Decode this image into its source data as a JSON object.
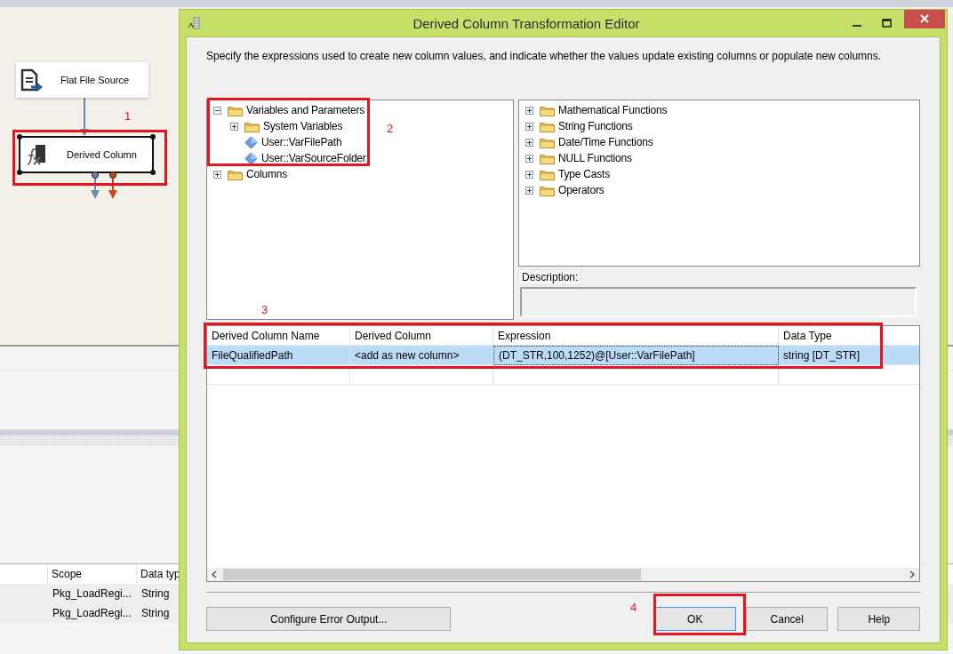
{
  "designer": {
    "nodes": [
      {
        "kind": "source",
        "label": "Flat File Source",
        "selected": false
      },
      {
        "kind": "derived",
        "label": "Derived Column",
        "selected": true,
        "callout": "1"
      }
    ]
  },
  "variables_grid": {
    "columns": [
      "Scope",
      "Data typ"
    ],
    "rows": [
      [
        "Pkg_LoadRegi...",
        "String"
      ],
      [
        "Pkg_LoadRegi...",
        "String"
      ]
    ]
  },
  "dialog": {
    "title": "Derived Column Transformation Editor",
    "instructions": "Specify the expressions used to create new column values, and indicate whether the values update existing columns or populate new columns.",
    "variables_tree": {
      "callout": "2",
      "items": [
        {
          "kind": "folder",
          "label": "Variables and Parameters",
          "expanded": true,
          "children": [
            {
              "kind": "folder",
              "label": "System Variables",
              "expanded": false
            },
            {
              "kind": "variable",
              "label": "User::VarFilePath"
            },
            {
              "kind": "variable",
              "label": "User::VarSourceFolder"
            }
          ]
        },
        {
          "kind": "folder",
          "label": "Columns",
          "expanded": false
        }
      ]
    },
    "functions_tree": {
      "items": [
        {
          "kind": "folder",
          "label": "Mathematical Functions",
          "expanded": false
        },
        {
          "kind": "folder",
          "label": "String Functions",
          "expanded": false
        },
        {
          "kind": "folder",
          "label": "Date/Time Functions",
          "expanded": false
        },
        {
          "kind": "folder",
          "label": "NULL Functions",
          "expanded": false
        },
        {
          "kind": "folder",
          "label": "Type Casts",
          "expanded": false
        },
        {
          "kind": "folder",
          "label": "Operators",
          "expanded": false
        }
      ]
    },
    "description_label": "Description:",
    "grid": {
      "callout": "3",
      "columns": [
        "Derived Column Name",
        "Derived Column",
        "Expression",
        "Data Type"
      ],
      "rows": [
        {
          "selected": true,
          "cells": [
            {
              "text": "FileQualifiedPath",
              "focused": false
            },
            {
              "text": "<add as new column>",
              "focused": false
            },
            {
              "text": "(DT_STR,100,1252)@[User::VarFilePath]",
              "focused": true
            },
            {
              "text": "string [DT_STR]",
              "focused": false
            }
          ]
        }
      ]
    },
    "buttons": [
      {
        "label": "Configure Error Output...",
        "focused": false
      },
      {
        "label": "OK",
        "focused": true,
        "callout": "4"
      },
      {
        "label": "Cancel",
        "focused": false
      },
      {
        "label": "Help",
        "focused": false
      }
    ]
  }
}
